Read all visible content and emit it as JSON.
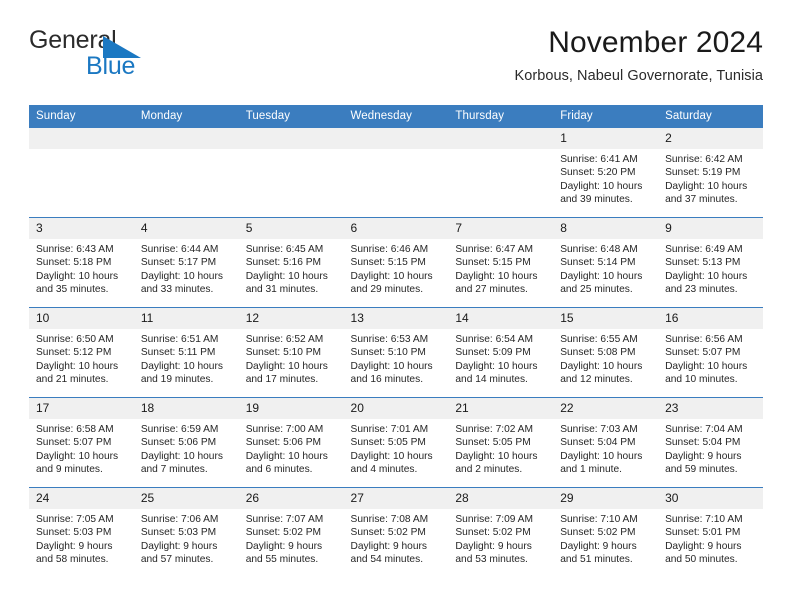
{
  "brand": {
    "word_one": "General",
    "word_two": "Blue",
    "triangle_icon": "brand-triangle-icon",
    "accent_color": "#1b78c2"
  },
  "header": {
    "title": "November 2024",
    "subtitle": "Korbous, Nabeul Governorate, Tunisia"
  },
  "theme": {
    "header_blue": "#3b7dbf",
    "daynum_gray": "#f0f0f0",
    "text": "#262626"
  },
  "calendar": {
    "weekday_headers": [
      "Sunday",
      "Monday",
      "Tuesday",
      "Wednesday",
      "Thursday",
      "Friday",
      "Saturday"
    ],
    "weeks": [
      [
        {
          "day": "",
          "sunrise": "",
          "sunset": "",
          "daylight": "",
          "empty": true
        },
        {
          "day": "",
          "sunrise": "",
          "sunset": "",
          "daylight": "",
          "empty": true
        },
        {
          "day": "",
          "sunrise": "",
          "sunset": "",
          "daylight": "",
          "empty": true
        },
        {
          "day": "",
          "sunrise": "",
          "sunset": "",
          "daylight": "",
          "empty": true
        },
        {
          "day": "",
          "sunrise": "",
          "sunset": "",
          "daylight": "",
          "empty": true
        },
        {
          "day": "1",
          "sunrise": "Sunrise: 6:41 AM",
          "sunset": "Sunset: 5:20 PM",
          "daylight": "Daylight: 10 hours and 39 minutes."
        },
        {
          "day": "2",
          "sunrise": "Sunrise: 6:42 AM",
          "sunset": "Sunset: 5:19 PM",
          "daylight": "Daylight: 10 hours and 37 minutes."
        }
      ],
      [
        {
          "day": "3",
          "sunrise": "Sunrise: 6:43 AM",
          "sunset": "Sunset: 5:18 PM",
          "daylight": "Daylight: 10 hours and 35 minutes."
        },
        {
          "day": "4",
          "sunrise": "Sunrise: 6:44 AM",
          "sunset": "Sunset: 5:17 PM",
          "daylight": "Daylight: 10 hours and 33 minutes."
        },
        {
          "day": "5",
          "sunrise": "Sunrise: 6:45 AM",
          "sunset": "Sunset: 5:16 PM",
          "daylight": "Daylight: 10 hours and 31 minutes."
        },
        {
          "day": "6",
          "sunrise": "Sunrise: 6:46 AM",
          "sunset": "Sunset: 5:15 PM",
          "daylight": "Daylight: 10 hours and 29 minutes."
        },
        {
          "day": "7",
          "sunrise": "Sunrise: 6:47 AM",
          "sunset": "Sunset: 5:15 PM",
          "daylight": "Daylight: 10 hours and 27 minutes."
        },
        {
          "day": "8",
          "sunrise": "Sunrise: 6:48 AM",
          "sunset": "Sunset: 5:14 PM",
          "daylight": "Daylight: 10 hours and 25 minutes."
        },
        {
          "day": "9",
          "sunrise": "Sunrise: 6:49 AM",
          "sunset": "Sunset: 5:13 PM",
          "daylight": "Daylight: 10 hours and 23 minutes."
        }
      ],
      [
        {
          "day": "10",
          "sunrise": "Sunrise: 6:50 AM",
          "sunset": "Sunset: 5:12 PM",
          "daylight": "Daylight: 10 hours and 21 minutes."
        },
        {
          "day": "11",
          "sunrise": "Sunrise: 6:51 AM",
          "sunset": "Sunset: 5:11 PM",
          "daylight": "Daylight: 10 hours and 19 minutes."
        },
        {
          "day": "12",
          "sunrise": "Sunrise: 6:52 AM",
          "sunset": "Sunset: 5:10 PM",
          "daylight": "Daylight: 10 hours and 17 minutes."
        },
        {
          "day": "13",
          "sunrise": "Sunrise: 6:53 AM",
          "sunset": "Sunset: 5:10 PM",
          "daylight": "Daylight: 10 hours and 16 minutes."
        },
        {
          "day": "14",
          "sunrise": "Sunrise: 6:54 AM",
          "sunset": "Sunset: 5:09 PM",
          "daylight": "Daylight: 10 hours and 14 minutes."
        },
        {
          "day": "15",
          "sunrise": "Sunrise: 6:55 AM",
          "sunset": "Sunset: 5:08 PM",
          "daylight": "Daylight: 10 hours and 12 minutes."
        },
        {
          "day": "16",
          "sunrise": "Sunrise: 6:56 AM",
          "sunset": "Sunset: 5:07 PM",
          "daylight": "Daylight: 10 hours and 10 minutes."
        }
      ],
      [
        {
          "day": "17",
          "sunrise": "Sunrise: 6:58 AM",
          "sunset": "Sunset: 5:07 PM",
          "daylight": "Daylight: 10 hours and 9 minutes."
        },
        {
          "day": "18",
          "sunrise": "Sunrise: 6:59 AM",
          "sunset": "Sunset: 5:06 PM",
          "daylight": "Daylight: 10 hours and 7 minutes."
        },
        {
          "day": "19",
          "sunrise": "Sunrise: 7:00 AM",
          "sunset": "Sunset: 5:06 PM",
          "daylight": "Daylight: 10 hours and 6 minutes."
        },
        {
          "day": "20",
          "sunrise": "Sunrise: 7:01 AM",
          "sunset": "Sunset: 5:05 PM",
          "daylight": "Daylight: 10 hours and 4 minutes."
        },
        {
          "day": "21",
          "sunrise": "Sunrise: 7:02 AM",
          "sunset": "Sunset: 5:05 PM",
          "daylight": "Daylight: 10 hours and 2 minutes."
        },
        {
          "day": "22",
          "sunrise": "Sunrise: 7:03 AM",
          "sunset": "Sunset: 5:04 PM",
          "daylight": "Daylight: 10 hours and 1 minute."
        },
        {
          "day": "23",
          "sunrise": "Sunrise: 7:04 AM",
          "sunset": "Sunset: 5:04 PM",
          "daylight": "Daylight: 9 hours and 59 minutes."
        }
      ],
      [
        {
          "day": "24",
          "sunrise": "Sunrise: 7:05 AM",
          "sunset": "Sunset: 5:03 PM",
          "daylight": "Daylight: 9 hours and 58 minutes."
        },
        {
          "day": "25",
          "sunrise": "Sunrise: 7:06 AM",
          "sunset": "Sunset: 5:03 PM",
          "daylight": "Daylight: 9 hours and 57 minutes."
        },
        {
          "day": "26",
          "sunrise": "Sunrise: 7:07 AM",
          "sunset": "Sunset: 5:02 PM",
          "daylight": "Daylight: 9 hours and 55 minutes."
        },
        {
          "day": "27",
          "sunrise": "Sunrise: 7:08 AM",
          "sunset": "Sunset: 5:02 PM",
          "daylight": "Daylight: 9 hours and 54 minutes."
        },
        {
          "day": "28",
          "sunrise": "Sunrise: 7:09 AM",
          "sunset": "Sunset: 5:02 PM",
          "daylight": "Daylight: 9 hours and 53 minutes."
        },
        {
          "day": "29",
          "sunrise": "Sunrise: 7:10 AM",
          "sunset": "Sunset: 5:02 PM",
          "daylight": "Daylight: 9 hours and 51 minutes."
        },
        {
          "day": "30",
          "sunrise": "Sunrise: 7:10 AM",
          "sunset": "Sunset: 5:01 PM",
          "daylight": "Daylight: 9 hours and 50 minutes."
        }
      ]
    ]
  }
}
